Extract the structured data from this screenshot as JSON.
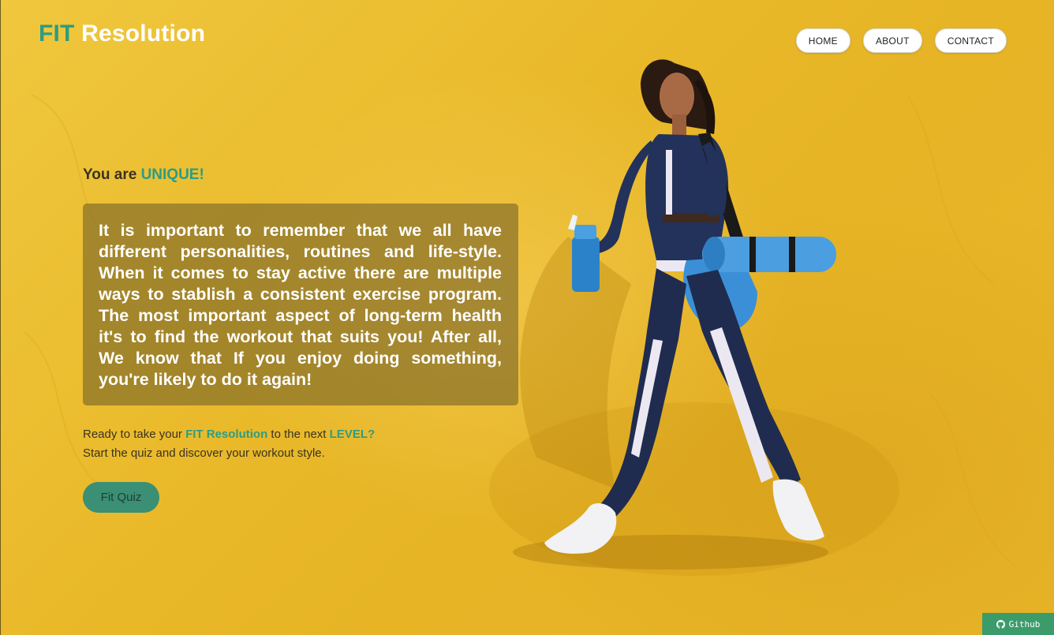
{
  "header": {
    "logo_fit": "FIT",
    "logo_resolution": "Resolution",
    "nav": [
      {
        "label": "HOME"
      },
      {
        "label": "ABOUT"
      },
      {
        "label": "CONTACT"
      }
    ]
  },
  "hero": {
    "tagline_prefix": "You are ",
    "tagline_accent": "UNIQUE!",
    "paragraph": "It is important to remember that we all have different personalities, routines and life-style. When it comes to stay active there are multiple ways to stablish a consistent exercise program. The most important aspect of long-term health it's to find the workout that suits you! After all, We know that If you enjoy doing something, you're likely to do it again!",
    "cta_line1_a": "Ready to take your ",
    "cta_line1_brand": "FIT Resolution",
    "cta_line1_b": " to the next ",
    "cta_line1_level": "LEVEL?",
    "cta_line2": "Start the quiz and discover your workout style.",
    "quiz_button": "Fit Quiz"
  },
  "footer": {
    "github_label": "Github",
    "github_icon": "github-icon"
  },
  "colors": {
    "accent": "#2e9c82",
    "background": "#e9b92a",
    "button": "#3a8f74",
    "github_badge": "#3c9b6a"
  }
}
